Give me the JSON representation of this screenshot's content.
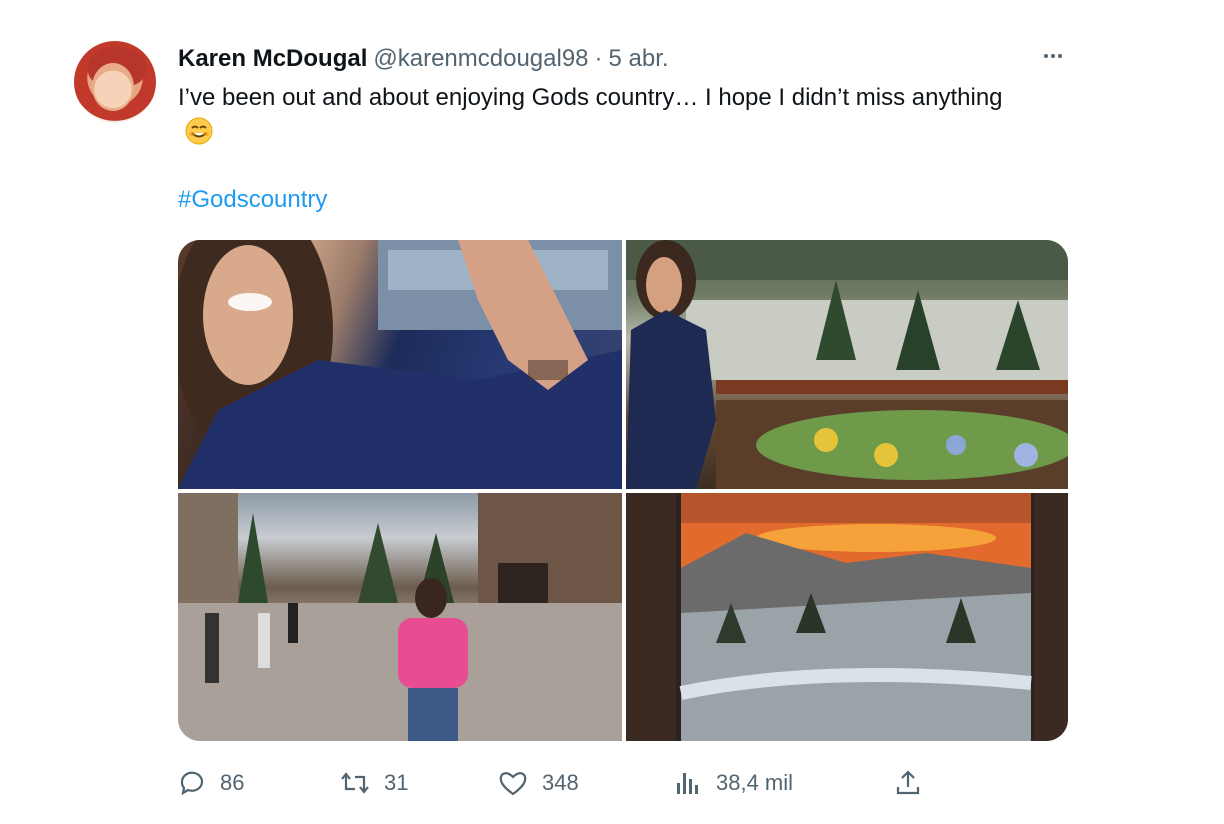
{
  "tweet": {
    "author_name": "Karen McDougal",
    "handle": "@karenmcdougal98",
    "separator": "·",
    "time": "5 abr.",
    "text": "I’ve been out and about enjoying Gods country… I hope I didn’t miss anything",
    "emoji_icon": "smiling-face-emoji",
    "hashtag": "#Godscountry",
    "media": [
      {
        "description_icon": "photo-woman-peace-sign"
      },
      {
        "description_icon": "photo-woman-balcony-mountains"
      },
      {
        "description_icon": "photo-woman-plaza-pink-sweater"
      },
      {
        "description_icon": "photo-sunset-mountain-window"
      }
    ]
  },
  "actions": {
    "reply_count": "86",
    "retweet_count": "31",
    "like_count": "348",
    "view_count": "38,4 mil"
  },
  "colors": {
    "link": "#1d9bf0",
    "secondary_text": "#536471",
    "primary_text": "#0f1419"
  }
}
